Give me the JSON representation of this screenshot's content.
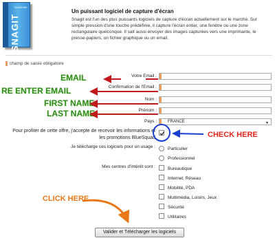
{
  "product": {
    "brand": "SNAGIT",
    "vendor": "TechSmith",
    "title": "Un puissant logiciel de capture d'écran",
    "description": "Snagit est l'un des plus puissants logiciels de capture d'écran actuellement sur le marché. Sur simple pression d'une touche prédéfinie, il capture l'écran entier, une fenêtre ou une zone rectangulaire quelconque. Il sait aussi envoyer des images capturées vers une imprimante, le presse-papiers, un fichier graphique ou un email."
  },
  "form": {
    "required_note": "champ de saisie obligatoire",
    "fields": {
      "email_label": "Votre Email :",
      "confirm_email_label": "Confirmation de l'Email :",
      "lastname_label": "Nom :",
      "firstname_label": "Prénom :",
      "country_label": "Pays :",
      "country_value": "FRANCE"
    },
    "consent_text": "Pour profiter de cette offre, j'accepte de recevoir les informations et les promotions BlueSquad",
    "consent_checked": true,
    "usage": {
      "label": "Je télécharge ces logiciels pour un usage :",
      "options": [
        "Particulier",
        "Professionnel"
      ]
    },
    "interests": {
      "label": "Mes centres d'intérêt sont :",
      "options": [
        "Bureautique",
        "Internet, Réseau",
        "Mobilité, PDA",
        "Multimédia, Loisirs, Jeux",
        "Sécurité",
        "Utilitaires"
      ]
    },
    "submit_label": "Valider et Télécharger les logiciels"
  },
  "annotations": {
    "email": "EMAIL",
    "re_enter_email": "RE ENTER EMAIL",
    "first_name": "FIRST NAME",
    "last_name": "LAST NAME",
    "check_here": "CHECK HERE",
    "click_here": "CLICK HERE"
  },
  "colors": {
    "annotation_green": "#2d8a17",
    "annotation_red": "#e0261b",
    "annotation_orange": "#e87818",
    "arrow_red": "#c0181b",
    "circle_blue": "#1a3fd0",
    "required_marker": "#e8a060"
  }
}
